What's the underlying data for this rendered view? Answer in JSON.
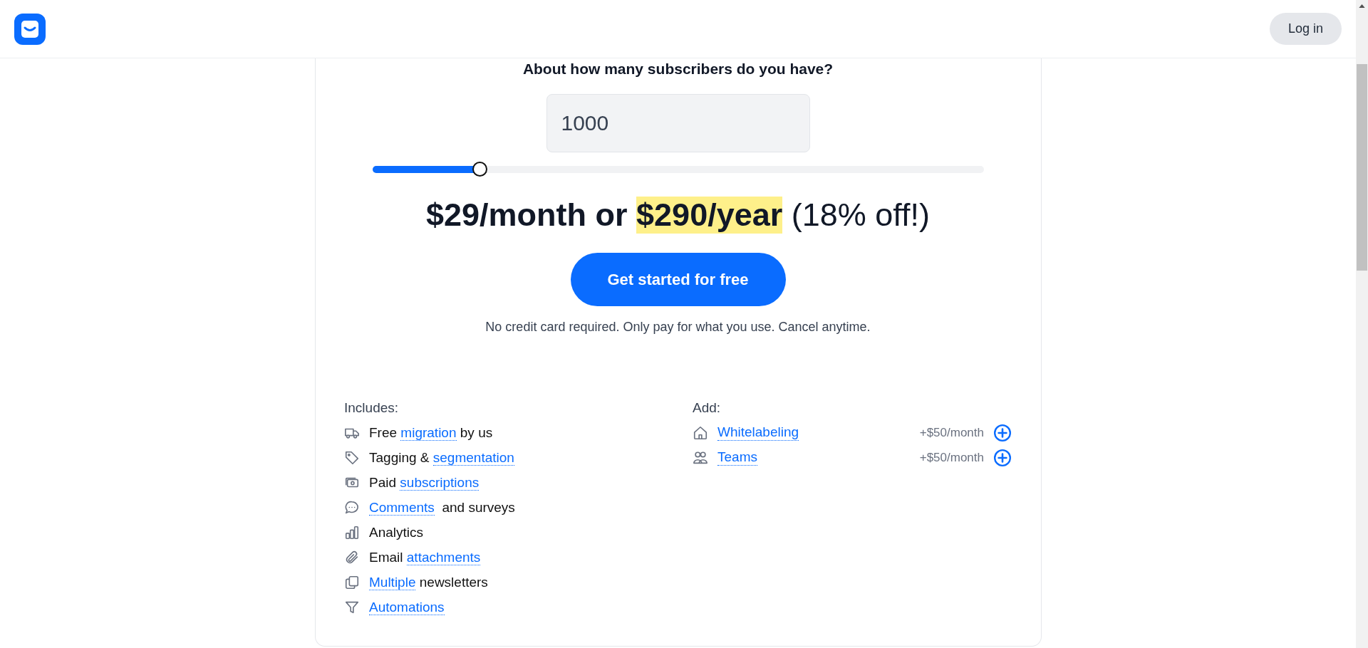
{
  "header": {
    "login": "Log in"
  },
  "pricing": {
    "question": "About how many subscribers do you have?",
    "subscribers": "1000",
    "slider": {
      "level": 0.176
    },
    "price": [
      {
        "text": "$29/month or ",
        "highlight": false,
        "bold": true
      },
      {
        "text": "$290/year",
        "highlight": true,
        "bold": true
      },
      {
        "text": " (18% off!)",
        "highlight": false,
        "bold": false
      }
    ],
    "cta": "Get started for free",
    "note": "No credit card required. Only pay for what you use. Cancel anytime."
  },
  "includes": {
    "title": "Includes:",
    "items": [
      [
        {
          "text": "Free ",
          "link": false
        },
        {
          "text": "migration",
          "link": true
        },
        {
          "text": " by us",
          "link": false
        }
      ],
      [
        {
          "text": "Tagging & ",
          "link": false
        },
        {
          "text": "segmentation",
          "link": true
        }
      ],
      [
        {
          "text": "Paid ",
          "link": false
        },
        {
          "text": "subscriptions",
          "link": true
        }
      ],
      [
        {
          "text": "Comments",
          "link": true
        },
        {
          "text": "  and surveys",
          "link": false
        }
      ],
      [
        {
          "text": "Analytics",
          "link": false
        }
      ],
      [
        {
          "text": "Email ",
          "link": false
        },
        {
          "text": "attachments",
          "link": true
        }
      ],
      [
        {
          "text": "Multiple",
          "link": true
        },
        {
          "text": " newsletters",
          "link": false
        }
      ],
      [
        {
          "text": "Automations",
          "link": true
        }
      ]
    ]
  },
  "add": {
    "title": "Add:",
    "items": [
      {
        "name": "Whitelabeling",
        "price": "+$50/month"
      },
      {
        "name": "Teams",
        "price": "+$50/month"
      }
    ]
  }
}
